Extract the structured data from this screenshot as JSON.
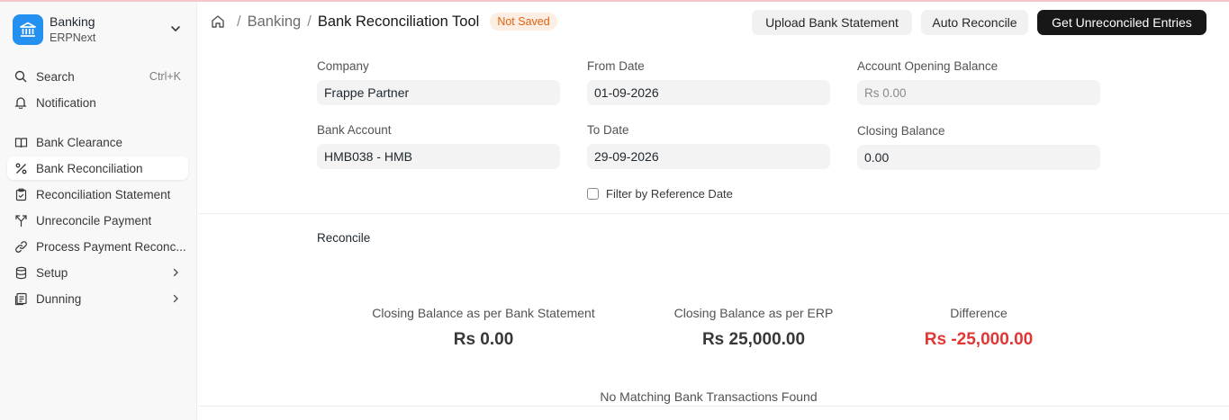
{
  "app": {
    "title": "Banking",
    "subtitle": "ERPNext",
    "accent": "#2490ef"
  },
  "sidebar": {
    "search": {
      "label": "Search",
      "shortcut": "Ctrl+K"
    },
    "notification": {
      "label": "Notification"
    },
    "items": [
      {
        "label": "Bank Clearance",
        "icon": "book-open-icon"
      },
      {
        "label": "Bank Reconciliation",
        "icon": "percent-icon",
        "active": true
      },
      {
        "label": "Reconciliation Statement",
        "icon": "clipboard-icon"
      },
      {
        "label": "Unreconcile Payment",
        "icon": "split-icon"
      },
      {
        "label": "Process Payment Reconc...",
        "icon": "link-icon"
      },
      {
        "label": "Setup",
        "icon": "database-icon",
        "has_children": true
      },
      {
        "label": "Dunning",
        "icon": "receipt-icon",
        "has_children": true
      }
    ]
  },
  "header": {
    "breadcrumb": [
      "Banking"
    ],
    "title": "Bank Reconciliation Tool",
    "status": "Not Saved",
    "buttons": {
      "upload": "Upload Bank Statement",
      "auto": "Auto Reconcile",
      "get": "Get Unreconciled Entries"
    }
  },
  "form": {
    "company": {
      "label": "Company",
      "value": "Frappe Partner"
    },
    "bank_account": {
      "label": "Bank Account",
      "value": "HMB038 - HMB"
    },
    "from_date": {
      "label": "From Date",
      "value": "01-09-2026"
    },
    "to_date": {
      "label": "To Date",
      "value": "29-09-2026"
    },
    "opening_balance": {
      "label": "Account Opening Balance",
      "value": "Rs 0.00"
    },
    "closing_balance": {
      "label": "Closing Balance",
      "value": "0.00"
    },
    "filter_ref_date": {
      "label": "Filter by Reference Date",
      "checked": false
    }
  },
  "reconcile": {
    "title": "Reconcile",
    "summary": [
      {
        "label": "Closing Balance as per Bank Statement",
        "value": "Rs 0.00"
      },
      {
        "label": "Closing Balance as per ERP",
        "value": "Rs 25,000.00"
      },
      {
        "label": "Difference",
        "value": "Rs -25,000.00",
        "negative": true
      }
    ],
    "empty_message": "No Matching Bank Transactions Found"
  }
}
